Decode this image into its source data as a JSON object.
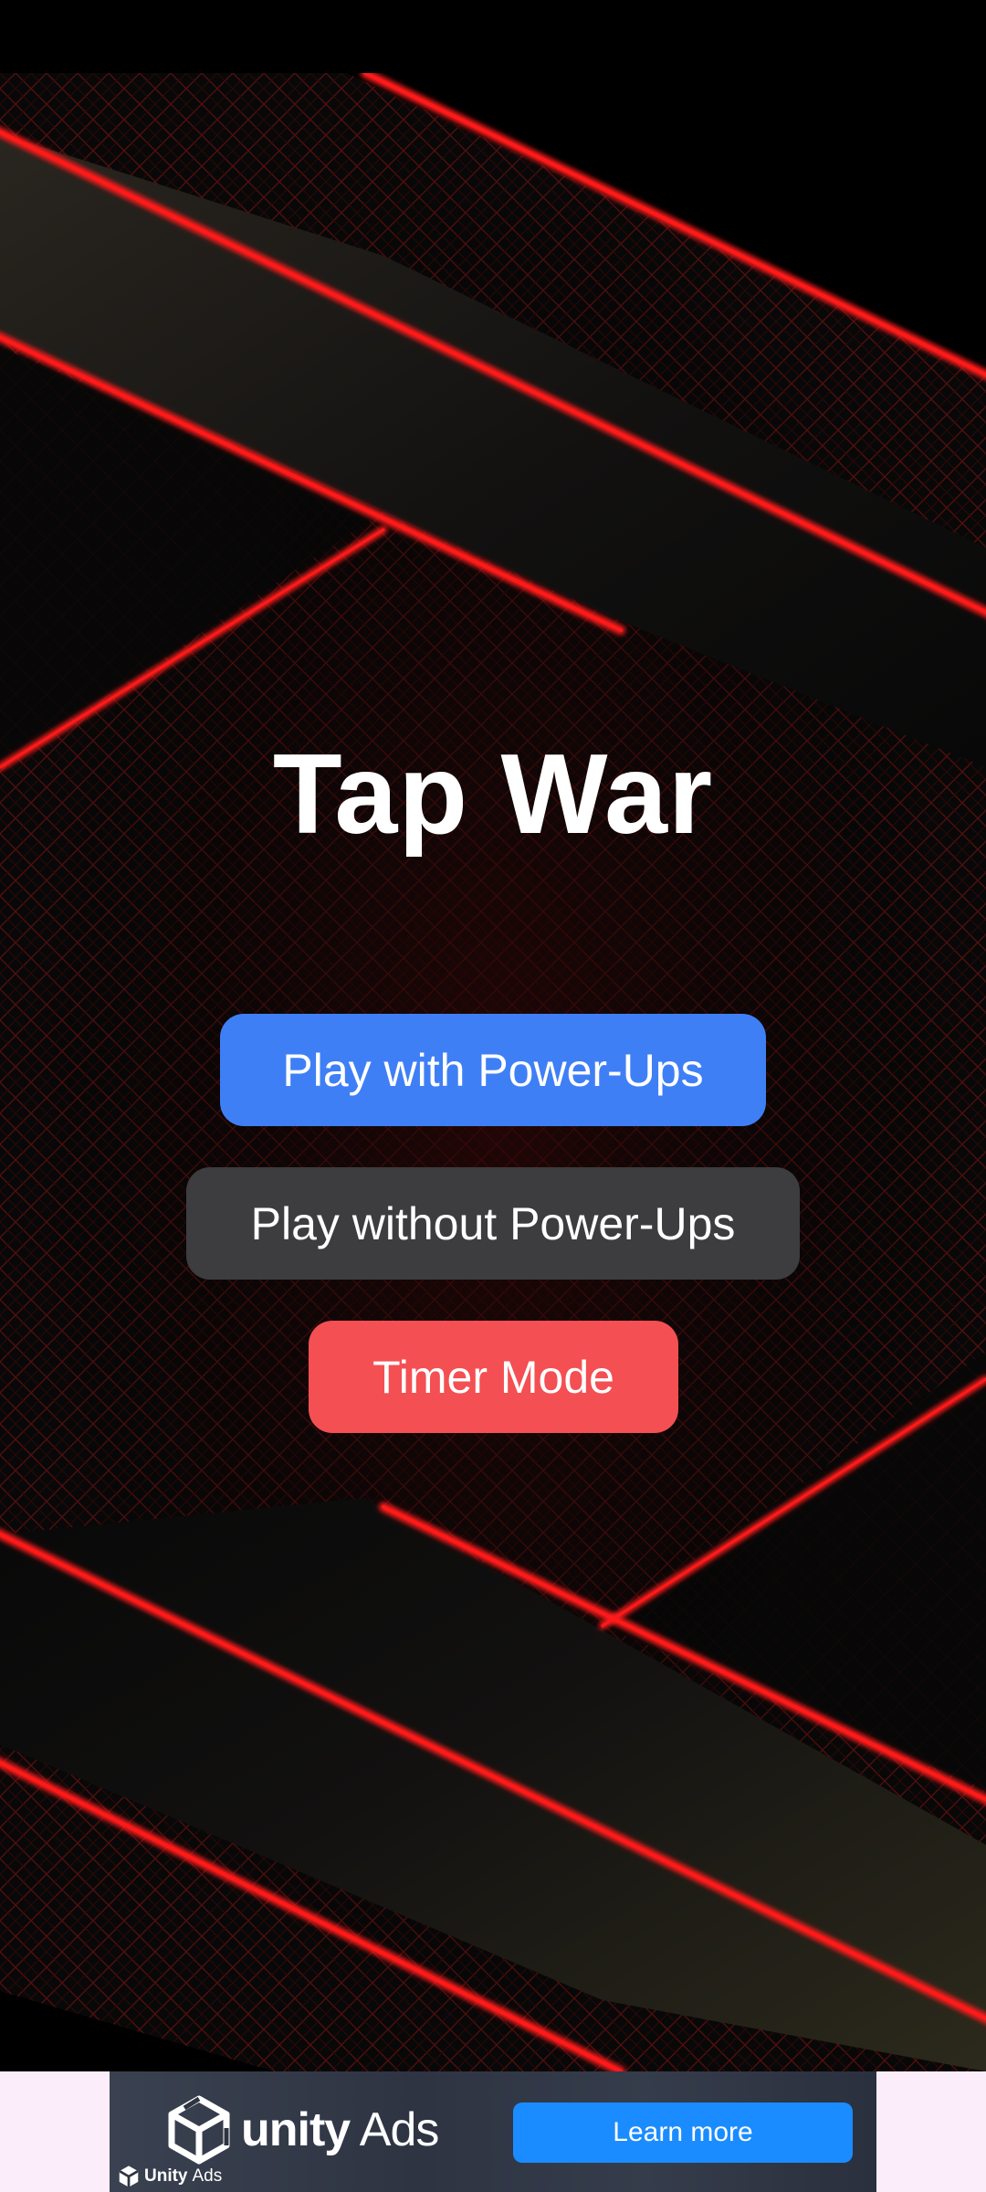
{
  "game": {
    "title": "Tap War",
    "buttons": {
      "power_ups": "Play with Power-Ups",
      "no_power_ups": "Play without Power-Ups",
      "timer_mode": "Timer Mode"
    }
  },
  "ad": {
    "brand_strong": "unity",
    "brand_light": "Ads",
    "cta": "Learn more",
    "mini_strong": "Unity",
    "mini_light": "Ads",
    "icon": "unity-logo-icon"
  },
  "colors": {
    "primary_button": "#3f7ff6",
    "secondary_button": "#3d3d3f",
    "danger_button": "#f44f53",
    "accent_red": "#ff1212",
    "ad_cta": "#1a8cff",
    "ad_background": "#fbeefa"
  }
}
